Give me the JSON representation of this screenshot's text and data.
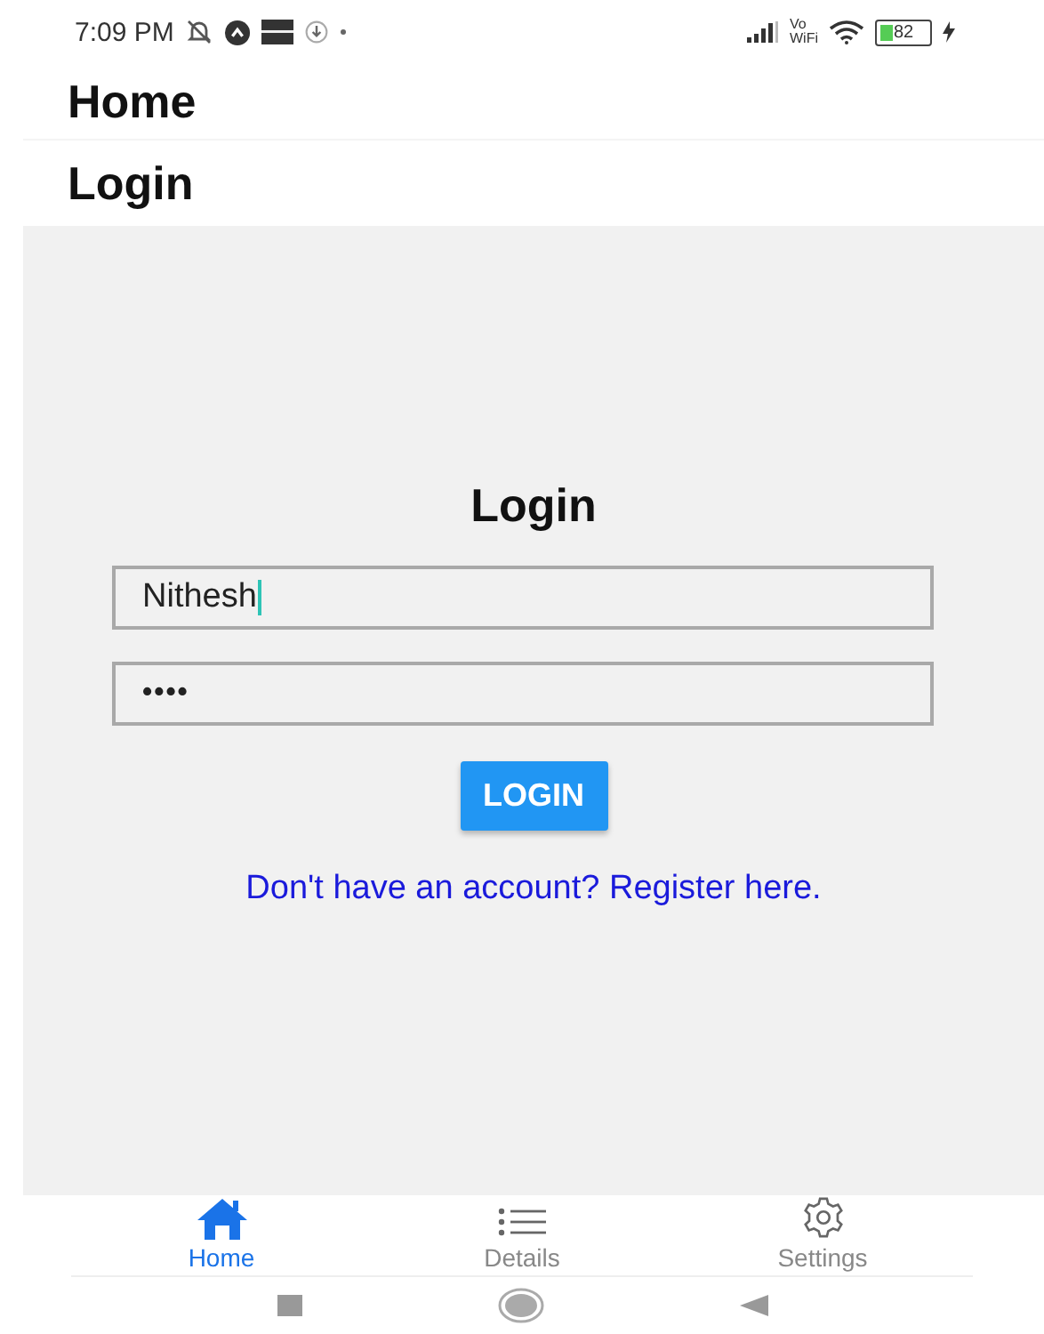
{
  "status_bar": {
    "time": "7:09 PM",
    "volte_top": "Vo",
    "volte_bottom": "WiFi",
    "battery": "82",
    "charging": true
  },
  "header": {
    "title": "Home"
  },
  "subheader": {
    "title": "Login"
  },
  "form": {
    "title": "Login",
    "username": {
      "value": "Nithesh",
      "focused": true
    },
    "password": {
      "value": "••••"
    },
    "button": "LOGIN",
    "link": "Don't have an account? Register here."
  },
  "tabs": [
    {
      "label": "Home",
      "kind": "home",
      "selected": true
    },
    {
      "label": "Details",
      "kind": "list",
      "selected": false
    },
    {
      "label": "Settings",
      "kind": "gear",
      "selected": false
    }
  ]
}
